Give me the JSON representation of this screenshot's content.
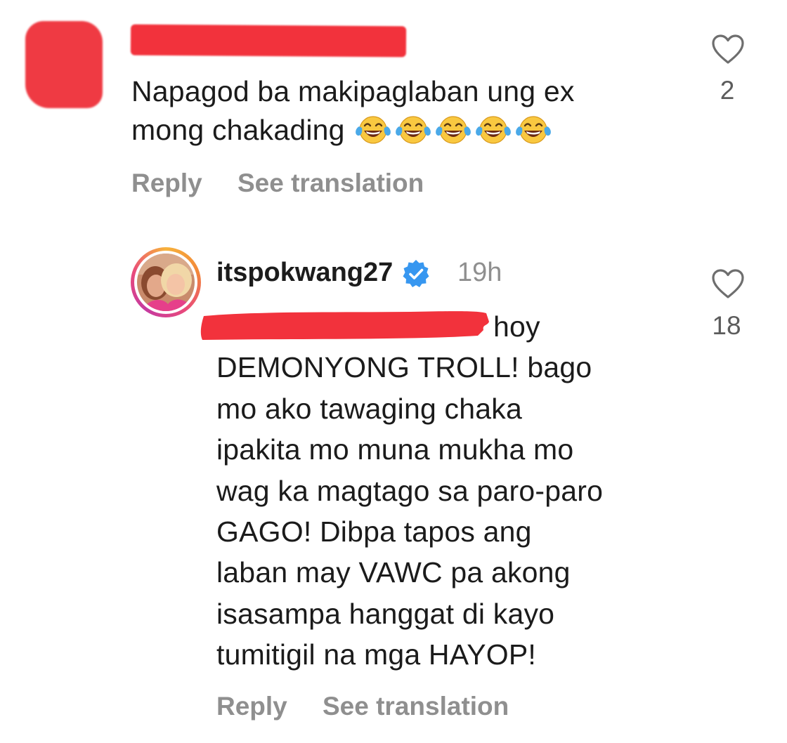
{
  "comment": {
    "text_line1": "Napagod ba makipaglaban ung ex",
    "text_line2": "mong chakading",
    "emoji": "face-with-tears-of-joy",
    "emoji_count": 5,
    "reply_label": "Reply",
    "translate_label": "See translation",
    "like_count": "2"
  },
  "reply": {
    "username": "itspokwang27",
    "verified": true,
    "timestamp": "19h",
    "lines": [
      "hoy",
      "DEMONYONG TROLL! bago",
      "mo ako tawaging chaka",
      "ipakita mo muna mukha mo",
      "wag ka magtago sa paro-paro",
      "GAGO! Dibpa tapos ang",
      "laban may VAWC pa akong",
      "isasampa hanggat di kayo",
      "tumitigil na mga HAYOP!"
    ],
    "reply_label": "Reply",
    "translate_label": "See translation",
    "like_count": "18"
  },
  "colors": {
    "redaction": "#f2323c",
    "secondary_text": "#8f8f8f",
    "verified_badge": "#3797f0"
  },
  "icons": [
    "heart-outline-icon",
    "verified-badge-icon",
    "laughing-emoji-icon"
  ]
}
